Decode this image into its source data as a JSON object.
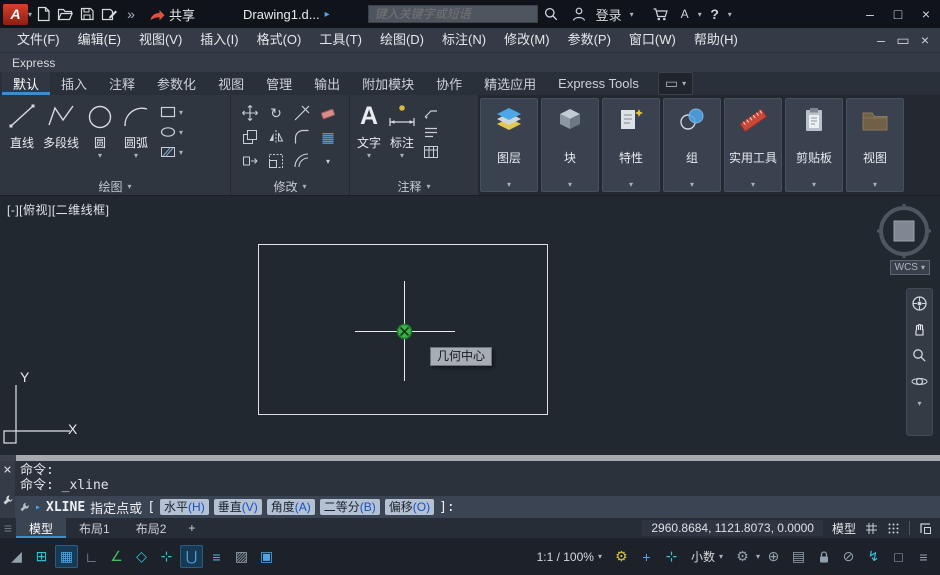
{
  "titlebar": {
    "logo_letter": "A",
    "share_label": "共享",
    "doc_title": "Drawing1.d...",
    "search_placeholder": "键入关键字或短语",
    "login_label": "登录"
  },
  "menubar": {
    "items": [
      "文件(F)",
      "编辑(E)",
      "视图(V)",
      "插入(I)",
      "格式(O)",
      "工具(T)",
      "绘图(D)",
      "标注(N)",
      "修改(M)",
      "参数(P)",
      "窗口(W)",
      "帮助(H)"
    ]
  },
  "express_label": "Express",
  "ribbon": {
    "tabs": [
      "默认",
      "插入",
      "注释",
      "参数化",
      "视图",
      "管理",
      "输出",
      "附加模块",
      "协作",
      "精选应用",
      "Express Tools"
    ],
    "active_tab": "默认",
    "draw": {
      "title": "绘图",
      "line": "直线",
      "polyline": "多段线",
      "circle": "圆",
      "arc": "圆弧"
    },
    "modify": {
      "title": "修改"
    },
    "annotate": {
      "title": "注释",
      "text": "文字",
      "dimension": "标注"
    },
    "layers_label": "图层",
    "block_label": "块",
    "properties_label": "特性",
    "group_label": "组",
    "utilities_label": "实用工具",
    "clipboard_label": "剪贴板",
    "view_label": "视图"
  },
  "canvas": {
    "viewport_controls": "[-][俯视][二维线框]",
    "snap_tooltip": "几何中心",
    "wcs_label": "WCS",
    "axis_x": "X",
    "axis_y": "Y"
  },
  "command": {
    "history": [
      "命令:",
      "命令: _xline"
    ],
    "prompt_cmd": "XLINE",
    "prompt_text": "指定点或",
    "open_bracket": "[",
    "options": [
      {
        "t": "水平",
        "k": "(H)"
      },
      {
        "t": "垂直",
        "k": "(V)"
      },
      {
        "t": "角度",
        "k": "(A)"
      },
      {
        "t": "二等分",
        "k": "(B)"
      },
      {
        "t": "偏移",
        "k": "(O)"
      }
    ],
    "close_bracket": "]:"
  },
  "layout": {
    "tabs": [
      "模型",
      "布局1",
      "布局2"
    ],
    "add_label": "+",
    "coordinates": "2960.8684, 1121.8073, 0.0000",
    "model_toggle": "模型"
  },
  "statusbar": {
    "scale": "1:1 / 100%",
    "units": "小数"
  },
  "colors": {
    "accent_blue": "#3f8ccc",
    "snap_green": "#3fae49",
    "canvas_bg": "#212830",
    "titlebar_bg": "#10141a"
  }
}
